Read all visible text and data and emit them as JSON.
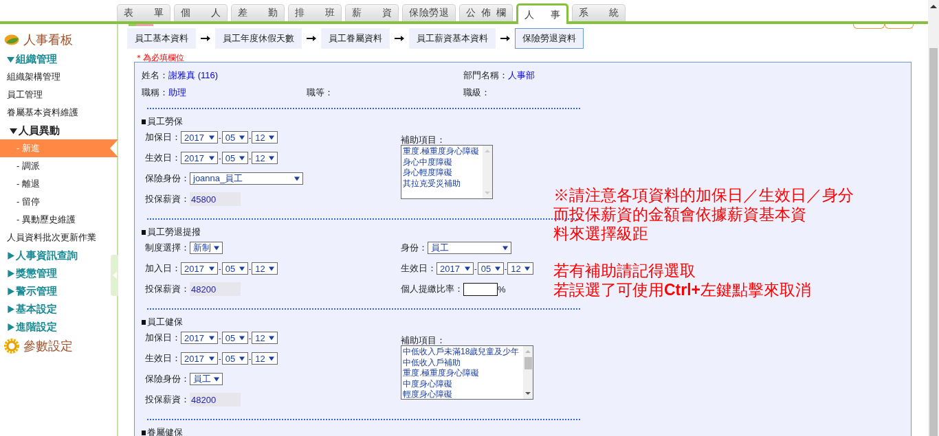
{
  "top_tabs": [
    {
      "label": "表單",
      "selected": false
    },
    {
      "label": "個人",
      "selected": false
    },
    {
      "label": "差勤",
      "selected": false
    },
    {
      "label": "排班",
      "selected": false
    },
    {
      "label": "薪資",
      "selected": false
    },
    {
      "label": "保險勞退",
      "selected": false
    },
    {
      "label": "公佈欄",
      "selected": false
    },
    {
      "label": "人事",
      "selected": true
    },
    {
      "label": "系統",
      "selected": false
    }
  ],
  "sidebar": {
    "title": "人事看板",
    "groups": [
      {
        "label": "組織管理",
        "expanded": true,
        "children": [
          {
            "label": "組織架構管理",
            "selected": false
          },
          {
            "label": "員工管理",
            "selected": false
          },
          {
            "label": "眷屬基本資料維護",
            "selected": false
          },
          {
            "label": "人員異動",
            "expanded": true,
            "children": [
              {
                "label": "- 新進",
                "selected": true
              },
              {
                "label": "- 調派",
                "selected": false
              },
              {
                "label": "- 離退",
                "selected": false
              },
              {
                "label": "- 留停",
                "selected": false
              },
              {
                "label": "- 異動歷史維護",
                "selected": false
              }
            ]
          },
          {
            "label": "人員資料批次更新作業",
            "selected": false
          }
        ]
      },
      {
        "label": "人事資訊查詢",
        "expanded": false
      },
      {
        "label": "獎懲管理",
        "expanded": false
      },
      {
        "label": "警示管理",
        "expanded": false
      },
      {
        "label": "基本設定",
        "expanded": false
      },
      {
        "label": "進階設定",
        "expanded": false
      }
    ],
    "footer": "參數設定"
  },
  "steps": [
    {
      "label": "員工基本資料",
      "selected": false
    },
    {
      "label": "員工年度休假天數",
      "selected": false
    },
    {
      "label": "員工眷屬資料",
      "selected": false
    },
    {
      "label": "員工薪資基本資料",
      "selected": false
    },
    {
      "label": "保險勞退資料",
      "selected": true
    }
  ],
  "required_note": "＊為必填欄位",
  "info": [
    {
      "label": "姓名：",
      "value": "謝雅真",
      "extra": "(116)"
    },
    {
      "label": "部門名稱：",
      "value": "人事部"
    },
    {
      "label": "職稱：",
      "value": "助理"
    },
    {
      "label": "職等："
    },
    {
      "label": "職級："
    }
  ],
  "sections": [
    {
      "title": "員工勞保",
      "left": [
        {
          "kind": "date",
          "label": "加保日：",
          "year": "2017",
          "month": "05",
          "day": "12",
          "separator": "-"
        },
        {
          "kind": "date",
          "label": "生效日：",
          "year": "2017",
          "month": "05",
          "day": "12",
          "separator": "-"
        },
        {
          "kind": "wide-select",
          "label": "保險身份：",
          "value": "joanna_員工"
        },
        {
          "kind": "readonly",
          "label": "投保薪資：",
          "value": "45800"
        }
      ],
      "right": [
        {
          "kind": "listbox",
          "label": "補助項目：",
          "options": [
            "重度.極重度身心障礙",
            "身心中度障礙",
            "身心輕度障礙",
            "其拉克受災補助"
          ]
        }
      ]
    },
    {
      "title": "員工勞退提撥",
      "left": [
        {
          "kind": "select",
          "label": "制度選擇：",
          "value": "新制"
        },
        {
          "kind": "date",
          "label": "加入日：",
          "year": "2017",
          "month": "05",
          "day": "12",
          "separator": "-"
        },
        {
          "kind": "readonly",
          "label": "投保薪資：",
          "value": "48200"
        }
      ],
      "right": [
        {
          "kind": "wide-select",
          "label": "身份：",
          "value": "員工"
        },
        {
          "kind": "date",
          "label": "生效日：",
          "year": "2017",
          "month": "05",
          "day": "12",
          "separator": "-"
        },
        {
          "kind": "percent",
          "label": "個人提繳比率：",
          "unit": "%"
        }
      ]
    },
    {
      "title": "員工健保",
      "left": [
        {
          "kind": "date",
          "label": "加保日：",
          "year": "2017",
          "month": "05",
          "day": "12",
          "separator": "-"
        },
        {
          "kind": "date",
          "label": "生效日：",
          "year": "2017",
          "month": "05",
          "day": "12",
          "separator": "-"
        },
        {
          "kind": "select",
          "label": "保險身份：",
          "value": "員工"
        },
        {
          "kind": "readonly",
          "label": "投保薪資：",
          "value": "48200"
        }
      ],
      "right": [
        {
          "kind": "listbox",
          "label": "補助項目：",
          "options": [
            "中低收入戶未滿18歲兒童及少年",
            "中低收入戶補助",
            "重度.極重度身心障礙",
            "中度身心障礙",
            "輕度身心障礙"
          ]
        }
      ]
    },
    {
      "title": "眷屬健保"
    }
  ],
  "notes": [
    {
      "lines": [
        "※請注意各項資料的加保日／生效日／身分",
        "而投保薪資的金額會依據薪資基本資",
        "料來選擇級距"
      ]
    },
    {
      "lines": [
        "若有補助請記得選取",
        "若誤選了可使用**Ctrl+**左鍵點擊來取消"
      ]
    }
  ]
}
